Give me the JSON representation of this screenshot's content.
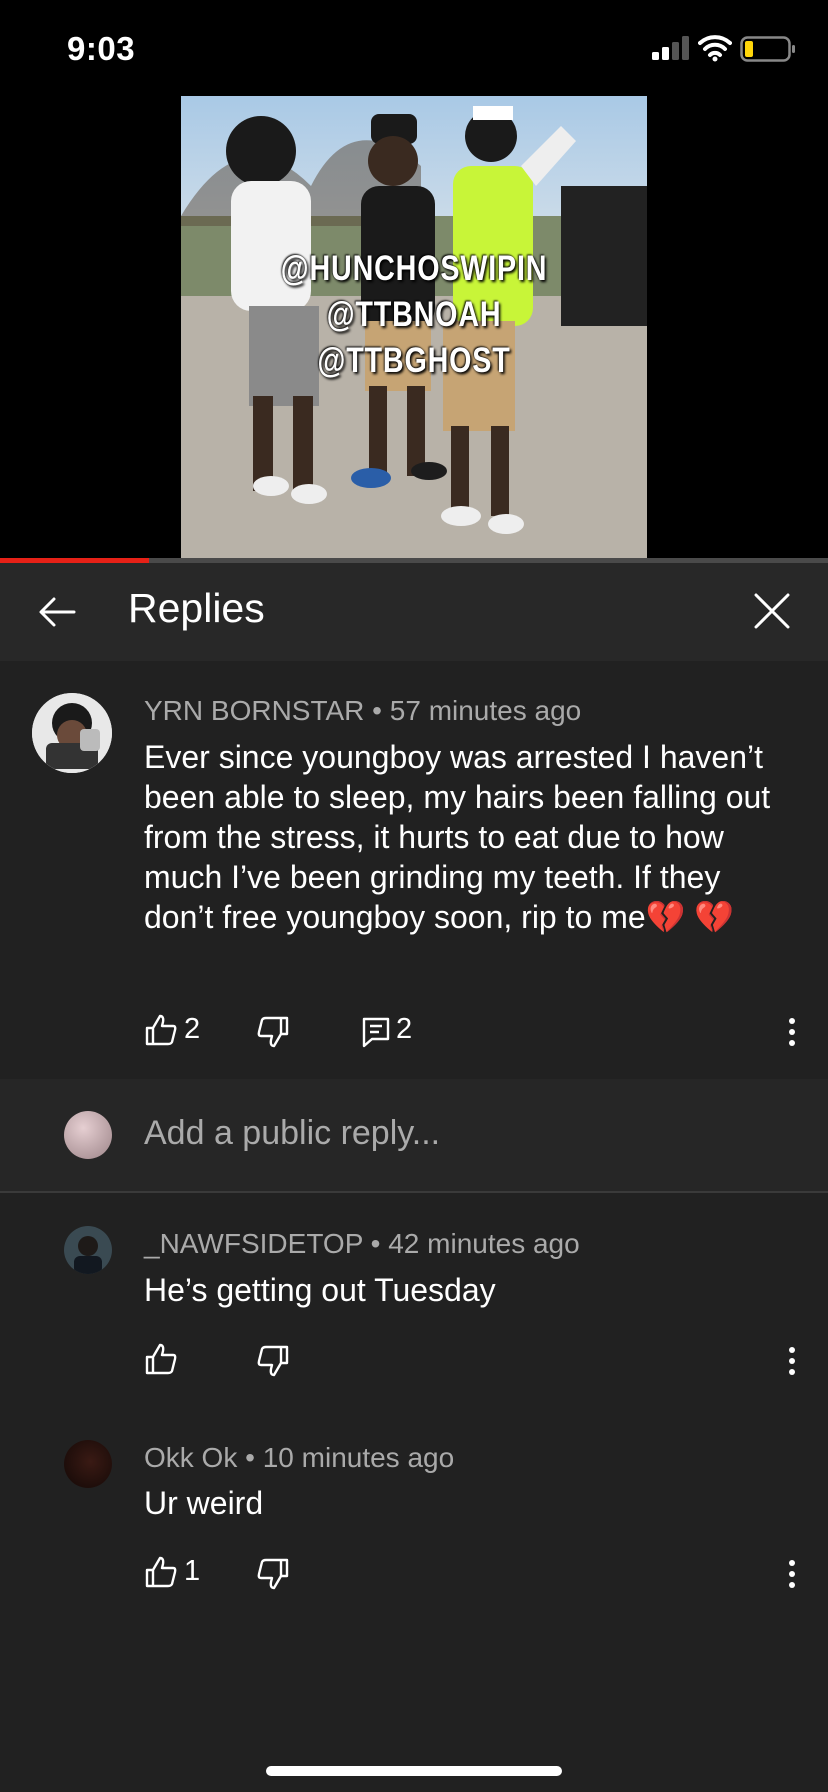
{
  "status_bar": {
    "time": "9:03"
  },
  "video": {
    "overlay_lines": [
      "@HUNCHOSWIPIN",
      "@TTBNOAH",
      "@TTBGHOST"
    ],
    "progress_fraction": 0.18
  },
  "header": {
    "title": "Replies"
  },
  "main_comment": {
    "author": "YRN BORNSTAR",
    "time": "57 minutes ago",
    "text": "Ever since youngboy was arrested I haven’t been able to sleep, my hairs been falling out from the stress, it hurts to eat due to how much I’ve been grinding my teeth. If they don’t free youngboy soon, rip to me",
    "emoji": "💔",
    "likes": "2",
    "replies": "2"
  },
  "reply_input": {
    "placeholder": "Add a public reply..."
  },
  "replies": [
    {
      "author": "_NAWFSIDETOP",
      "time": "42 minutes ago",
      "text": "He’s getting out Tuesday",
      "likes": ""
    },
    {
      "author": "Okk Ok",
      "time": "10 minutes ago",
      "text": "Ur weird",
      "likes": "1"
    }
  ],
  "colors": {
    "accent": "#e62117",
    "background": "#212121",
    "header": "#282828",
    "secondary_text": "#aaaaaa"
  },
  "icons": [
    "back-arrow-icon",
    "close-icon",
    "thumbs-up-icon",
    "thumbs-down-icon",
    "reply-icon",
    "more-vert-icon",
    "signal-icon",
    "wifi-icon",
    "battery-icon"
  ]
}
